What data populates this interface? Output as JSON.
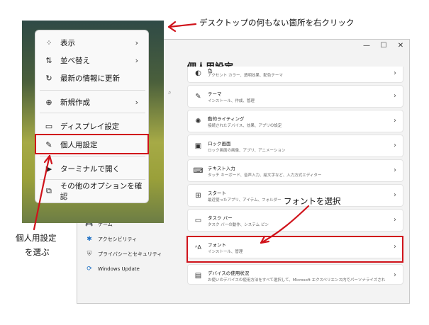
{
  "window": {
    "title": "個人用設定"
  },
  "left_nav": [
    {
      "label": "ゲーム",
      "icon": "gamepad-icon"
    },
    {
      "label": "アクセシビリティ",
      "icon": "accessibility-icon"
    },
    {
      "label": "プライバシーとセキュリティ",
      "icon": "shield-icon"
    },
    {
      "label": "Windows Update",
      "icon": "update-icon"
    }
  ],
  "settings_cards": [
    {
      "title": "色",
      "subtitle": "アクセント カラー、透明効果、配色テーマ",
      "icon": "palette-icon"
    },
    {
      "title": "テーマ",
      "subtitle": "インストール、作成、管理",
      "icon": "brush-icon"
    },
    {
      "title": "動的ライティング",
      "subtitle": "接続されたデバイス、効果、アプリの設定",
      "icon": "lighting-icon"
    },
    {
      "title": "ロック画面",
      "subtitle": "ロック画面の画像、アプリ、アニメーション",
      "icon": "lock-screen-icon"
    },
    {
      "title": "テキスト入力",
      "subtitle": "タッチ キーボード、音声入力、絵文字など、入力方式エディター",
      "icon": "keyboard-icon"
    },
    {
      "title": "スタート",
      "subtitle": "最近使ったアプリ、アイテム、フォルダー",
      "icon": "start-icon"
    },
    {
      "title": "タスク バー",
      "subtitle": "タスク バーの動作、システム ピン",
      "icon": "taskbar-icon"
    },
    {
      "title": "フォント",
      "subtitle": "インストール、管理",
      "icon": "font-icon"
    },
    {
      "title": "デバイスの使用状況",
      "subtitle": "お使いのデバイスの使用方法をすべて選択して、Microsoft エクスペリエンス内でパーソナライズされたヒント、広告、推奨事項を取得します。",
      "icon": "device-usage-icon"
    }
  ],
  "context_menu": [
    {
      "label": "表示",
      "icon": "view-grid-icon",
      "submenu": true
    },
    {
      "label": "並べ替え",
      "icon": "sort-icon",
      "submenu": true
    },
    {
      "label": "最新の情報に更新",
      "icon": "refresh-icon",
      "submenu": false
    },
    {
      "label": "新規作成",
      "icon": "new-icon",
      "submenu": true
    },
    {
      "label": "ディスプレイ設定",
      "icon": "display-icon",
      "submenu": false
    },
    {
      "label": "個人用設定",
      "icon": "pen-icon",
      "submenu": false
    },
    {
      "label": "ターミナルで開く",
      "icon": "terminal-icon",
      "submenu": false
    },
    {
      "label": "その他のオプションを確認",
      "icon": "more-options-icon",
      "submenu": false
    }
  ],
  "annotations": {
    "right_click": "デスクトップの何もない箇所を右クリック",
    "select_font": "フォントを選択",
    "select_personal_line1": "個人用設定",
    "select_personal_line2": "を選ぶ"
  },
  "colors": {
    "highlight": "#d0131b",
    "settings_bg": "#f3f3f3"
  }
}
